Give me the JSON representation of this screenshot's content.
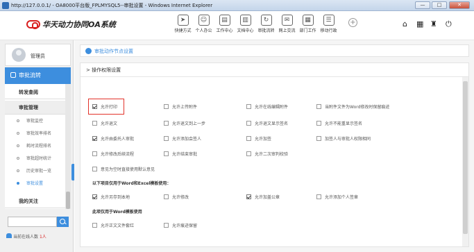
{
  "window": {
    "title": "http://127.0.0.1/ - OA8000平台版_FPLMYSQL5--审批设置 - Windows Internet Explorer",
    "minimize": "—",
    "maximize": "□",
    "close": "✕"
  },
  "app": {
    "logo_text": "华天动力协同OA系统"
  },
  "topnav": [
    {
      "label": "快捷方式",
      "glyph": "➤",
      "icon": "send-icon"
    },
    {
      "label": "个人办公",
      "glyph": "☺",
      "icon": "person-icon"
    },
    {
      "label": "工作中心",
      "glyph": "▤",
      "icon": "briefcase-icon"
    },
    {
      "label": "文档中心",
      "glyph": "▥",
      "icon": "folder-icon"
    },
    {
      "label": "审批流转",
      "glyph": "↻",
      "icon": "flow-icon"
    },
    {
      "label": "网上交流",
      "glyph": "✉",
      "icon": "chat-icon"
    },
    {
      "label": "部门工作",
      "glyph": "▦",
      "icon": "department-icon"
    },
    {
      "label": "移动行政",
      "glyph": "☰",
      "icon": "mobile-icon"
    }
  ],
  "header_icons": {
    "plus": "+",
    "home": "⌂",
    "grid": "▦",
    "shirt": "♜",
    "power": "⏻"
  },
  "user": {
    "name": "管理员"
  },
  "sidebar": {
    "section": "审批流转",
    "groups": [
      "转发查阅",
      "审批管理",
      "我的关注"
    ],
    "items": [
      "审批监控",
      "审批效率排名",
      "耗时流程排名",
      "审批超时统计",
      "历史审批一览",
      "审批设置"
    ],
    "search_placeholder": "",
    "online_label": "当前在线人数",
    "online_count": "1人"
  },
  "breadcrumb": "审批动作节点设置",
  "panel": {
    "title": "> 操作权限设置",
    "options": [
      {
        "label": "允许打印",
        "checked": true
      },
      {
        "label": "允许上传附件",
        "checked": false
      },
      {
        "label": "允许在线编辑附件",
        "checked": false
      },
      {
        "label": "当附件文件为Word修改时保留痕迹",
        "checked": false
      },
      {
        "label": "允许退文",
        "checked": false
      },
      {
        "label": "允许退文到上一步",
        "checked": false
      },
      {
        "label": "允许退文显示签名",
        "checked": false
      },
      {
        "label": "允许不能重显示签名",
        "checked": false
      },
      {
        "label": "允许由委托人审批",
        "checked": true
      },
      {
        "label": "允许添加会签人",
        "checked": false
      },
      {
        "label": "允许加签",
        "checked": false
      },
      {
        "label": "加签人与审批人权限相同",
        "checked": false
      },
      {
        "label": "允许修改后续流程",
        "checked": false
      },
      {
        "label": "允许结束审批",
        "checked": false
      },
      {
        "label": "允许二次审判校验",
        "checked": false
      },
      {
        "label": "意见为空时直接使用默认意见",
        "checked": false
      }
    ],
    "section_word_excel": "以下项目仅用于Word和Excel模板使用：",
    "word_excel_options": [
      {
        "label": "允许另存到本地",
        "checked": true
      },
      {
        "label": "允许修改",
        "checked": false
      },
      {
        "label": "允许加盖公章",
        "checked": true
      },
      {
        "label": "允许添加个人签章",
        "checked": false
      }
    ],
    "section_word": "此项仅用于Word模板使用",
    "word_options": [
      {
        "label": "允许正文文件套红",
        "checked": false
      },
      {
        "label": "允许痕迹保留",
        "checked": false
      }
    ]
  }
}
